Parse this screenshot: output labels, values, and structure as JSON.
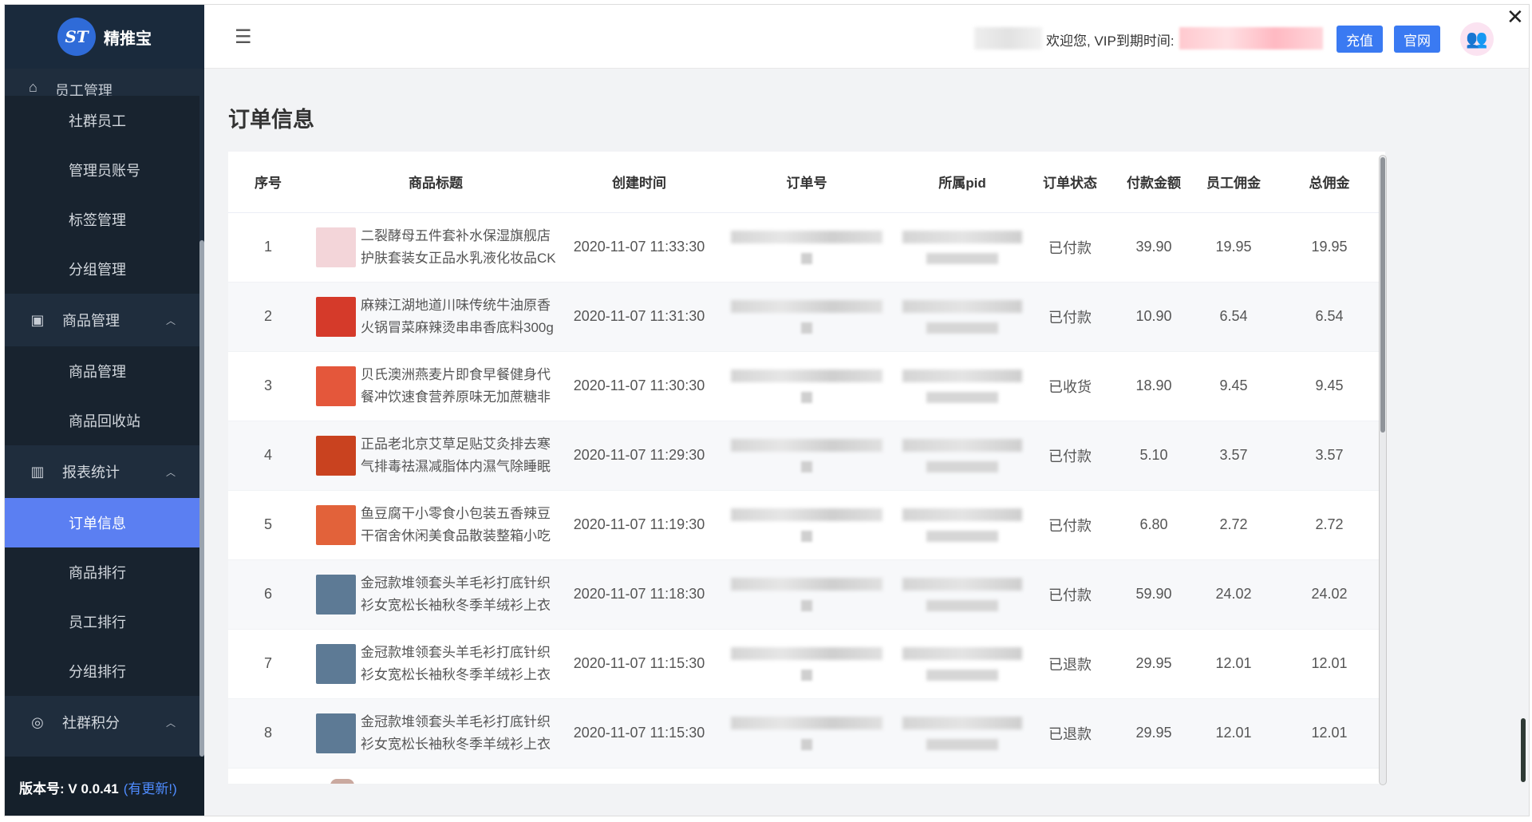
{
  "app": {
    "logo_text": "精推宝",
    "logo_mark": "ST"
  },
  "sidebar": {
    "partial_item": "员工管理",
    "sections": [
      {
        "type": "item",
        "label": "社群员工"
      },
      {
        "type": "item",
        "label": "管理员账号"
      },
      {
        "type": "item",
        "label": "标签管理"
      },
      {
        "type": "item",
        "label": "分组管理"
      },
      {
        "type": "group",
        "label": "商品管理",
        "icon": "clipboard-icon"
      },
      {
        "type": "item",
        "label": "商品管理"
      },
      {
        "type": "item",
        "label": "商品回收站"
      },
      {
        "type": "group",
        "label": "报表统计",
        "icon": "bar-chart-icon"
      },
      {
        "type": "item",
        "label": "订单信息",
        "active": true
      },
      {
        "type": "item",
        "label": "商品排行"
      },
      {
        "type": "item",
        "label": "员工排行"
      },
      {
        "type": "item",
        "label": "分组排行"
      },
      {
        "type": "group",
        "label": "社群积分",
        "icon": "points-icon"
      }
    ],
    "version_label": "版本号: V 0.0.41",
    "update_label": "(有更新!)"
  },
  "header": {
    "welcome_text": "欢迎您, VIP到期时间:",
    "recharge_label": "充值",
    "site_label": "官网"
  },
  "main": {
    "title": "订单信息",
    "columns": [
      "序号",
      "商品标题",
      "创建时间",
      "订单号",
      "所属pid",
      "订单状态",
      "付款金额",
      "员工佣金",
      "总佣金"
    ],
    "rows": [
      {
        "no": "1",
        "title": "二裂酵母五件套补水保湿旗舰店护肤套装女正品水乳液化妆品CK",
        "time": "2020-11-07 11:33:30",
        "status": "已付款",
        "pay": "39.90",
        "staff": "19.95",
        "total": "19.95",
        "thumb_color": "#f3d5d9"
      },
      {
        "no": "2",
        "title": "麻辣江湖地道川味传统牛油原香火锅冒菜麻辣烫串串香底料300g",
        "time": "2020-11-07 11:31:30",
        "status": "已付款",
        "pay": "10.90",
        "staff": "6.54",
        "total": "6.54",
        "thumb_color": "#d53a2a"
      },
      {
        "no": "3",
        "title": "贝氏澳洲燕麦片即食早餐健身代餐冲饮速食营养原味无加蔗糖非脱脂",
        "time": "2020-11-07 11:30:30",
        "status": "已收货",
        "pay": "18.90",
        "staff": "9.45",
        "total": "9.45",
        "thumb_color": "#e4573b"
      },
      {
        "no": "4",
        "title": "正品老北京艾草足贴艾灸排去寒气排毒祛濕减脂体内濕气除睡眠脚贴",
        "time": "2020-11-07 11:29:30",
        "status": "已付款",
        "pay": "5.10",
        "staff": "3.57",
        "total": "3.57",
        "thumb_color": "#c9421f"
      },
      {
        "no": "5",
        "title": "鱼豆腐干小零食小包装五香辣豆干宿舍休闲美食品散装整箱小吃麻辣",
        "time": "2020-11-07 11:19:30",
        "status": "已付款",
        "pay": "6.80",
        "staff": "2.72",
        "total": "2.72",
        "thumb_color": "#e2623a"
      },
      {
        "no": "6",
        "title": "金冠款堆领套头羊毛衫打底针织衫女宽松长袖秋冬季羊绒衫上衣",
        "time": "2020-11-07 11:18:30",
        "status": "已付款",
        "pay": "59.90",
        "staff": "24.02",
        "total": "24.02",
        "thumb_color": "#5d7a95"
      },
      {
        "no": "7",
        "title": "金冠款堆领套头羊毛衫打底针织衫女宽松长袖秋冬季羊绒衫上衣",
        "time": "2020-11-07 11:15:30",
        "status": "已退款",
        "pay": "29.95",
        "staff": "12.01",
        "total": "12.01",
        "thumb_color": "#5d7a95"
      },
      {
        "no": "8",
        "title": "金冠款堆领套头羊毛衫打底针织衫女宽松长袖秋冬季羊绒衫上衣",
        "time": "2020-11-07 11:15:30",
        "status": "已退款",
        "pay": "29.95",
        "staff": "12.01",
        "total": "12.01",
        "thumb_color": "#5d7a95"
      }
    ]
  },
  "colors": {
    "accent": "#3a7af2",
    "active_menu": "#5b7ff2",
    "sidebar_bg": "#1f2d3d"
  }
}
